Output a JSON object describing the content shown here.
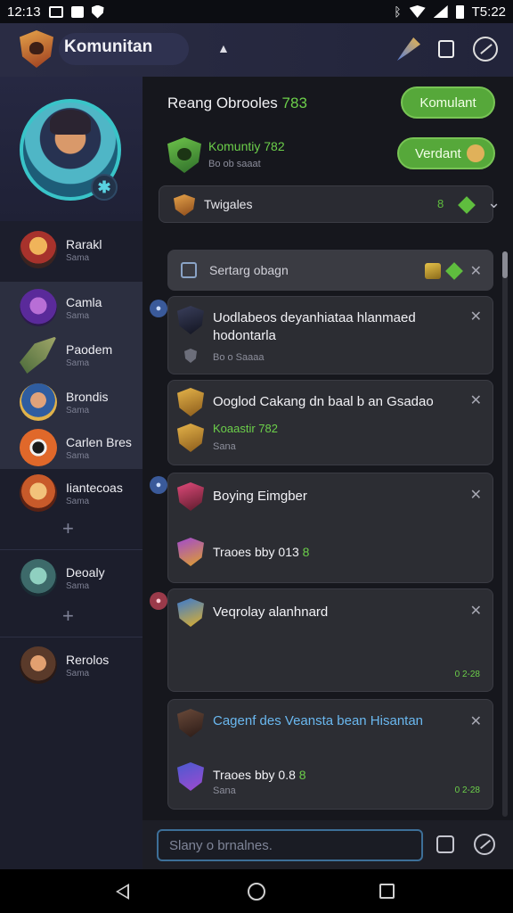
{
  "status_bar": {
    "time": "12:13",
    "right_time": "T5:22",
    "icons": [
      "photo-icon",
      "box-icon",
      "shield-icon",
      "bluetooth-icon",
      "wifi-icon",
      "signal-icon",
      "battery-icon"
    ]
  },
  "header": {
    "title": "Komunitan",
    "icons": [
      "guild-logo-icon",
      "caret-up-icon",
      "rocket-icon",
      "square-icon",
      "compass-icon"
    ]
  },
  "sidebar": {
    "items": [
      {
        "name": "Rarakl",
        "sub": "Sama"
      },
      {
        "name": "Camla",
        "sub": "Sama"
      },
      {
        "name": "Paodem",
        "sub": "Sama"
      },
      {
        "name": "Brondis",
        "sub": "Sama"
      },
      {
        "name": "Carlen Bres",
        "sub": "Sama"
      },
      {
        "name": "Iiantecoas",
        "sub": "Sama"
      },
      {
        "name": "Deoaly",
        "sub": "Sama"
      },
      {
        "name": "Rerolos",
        "sub": "Sama"
      }
    ],
    "add_symbol": "+"
  },
  "main": {
    "room_title": "Reang Obrooles",
    "room_number": "783",
    "btn_komunitas": "Komulant",
    "btn_verdant": "Verdant",
    "group_name": "Komuntiy",
    "group_number": "782",
    "group_sub": "Bo ob saaat",
    "filter_label": "Twigales",
    "filter_count": "8",
    "search_label": "Sertarg obagn",
    "notifications": [
      {
        "title": "Uodlabeos deyanhiataa hlanmaed hodontarla",
        "sub": "Bo o Saaaa"
      },
      {
        "title": "Ooglod Cakang dn baal b an Gsadao",
        "green": "Koaastir 782",
        "sub": "Sana"
      },
      {
        "title": "Boying Eimgber",
        "line2": "Traoes bby 013",
        "line2_num": "8"
      },
      {
        "title": "Veqrolay alanhnard",
        "meta": "0 2-28"
      },
      {
        "title": "Cagenf des Veansta bean Hisantan",
        "line2": "Traoes bby 0.8",
        "line2_num": "8",
        "sub": "Sana",
        "meta": "0 2-28"
      }
    ]
  },
  "composer": {
    "placeholder": "Slany o brnalnes."
  },
  "colors": {
    "accent_green": "#56a83a",
    "header_bg": "#2a2c44",
    "sidebar_bg": "#1c1e2c",
    "main_bg": "#16171d",
    "card_bg": "#2c2d33",
    "input_border": "#3d6f98"
  }
}
